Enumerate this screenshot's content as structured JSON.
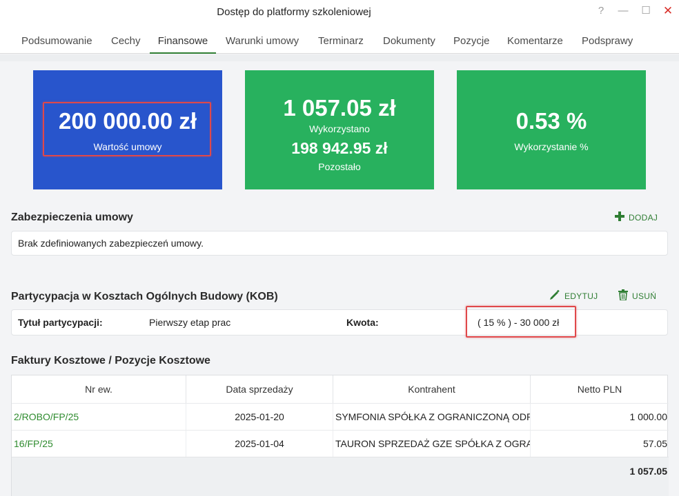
{
  "window": {
    "title": "Dostęp do platformy szkoleniowej",
    "help": "?",
    "minimize": "—",
    "maximize": "☐",
    "close": "✕"
  },
  "tabs": [
    {
      "label": "Podsumowanie"
    },
    {
      "label": "Cechy"
    },
    {
      "label": "Finansowe",
      "active": true
    },
    {
      "label": "Warunki umowy"
    },
    {
      "label": "Terminarz"
    },
    {
      "label": "Dokumenty"
    },
    {
      "label": "Pozycje"
    },
    {
      "label": "Komentarze"
    },
    {
      "label": "Podsprawy"
    }
  ],
  "tiles": {
    "contract_value": {
      "value": "200 000.00 zł",
      "label": "Wartość umowy"
    },
    "used": {
      "value": "1 057.05 zł",
      "label": "Wykorzystano",
      "remaining_value": "198 942.95 zł",
      "remaining_label": "Pozostało"
    },
    "usage_percent": {
      "value": "0.53 %",
      "label": "Wykorzystanie %"
    }
  },
  "securities": {
    "title": "Zabezpieczenia umowy",
    "add_label": "DODAJ",
    "empty_text": "Brak zdefiniowanych zabezpieczeń umowy."
  },
  "kob": {
    "title": "Partycypacja w Kosztach Ogólnych Budowy (KOB)",
    "edit_label": "EDYTUJ",
    "delete_label": "USUŃ",
    "title_label": "Tytuł partycypacji:",
    "title_value": "Pierwszy etap prac",
    "amount_label": "Kwota:",
    "amount_value": "( 15 % ) - 30 000 zł"
  },
  "invoices": {
    "title": "Faktury Kosztowe / Pozycje Kosztowe",
    "columns": [
      "Nr ew.",
      "Data sprzedaży",
      "Kontrahent",
      "Netto PLN"
    ],
    "rows": [
      {
        "nr": "2/ROBO/FP/25",
        "date": "2025-01-20",
        "contractor": "SYMFONIA SPÓŁKA Z OGRANICZONĄ ODPOWIEDZIALNOŚCIĄ",
        "net": "1 000.00"
      },
      {
        "nr": "16/FP/25",
        "date": "2025-01-04",
        "contractor": "TAURON SPRZEDAŻ GZE SPÓŁKA Z OGRANICZONĄ ODPOWIEDZIALNOŚCIĄ",
        "net": "57.05"
      }
    ],
    "total": "1 057.05"
  },
  "colors": {
    "accent_green": "#2e7d32",
    "tile_blue": "#2855cc",
    "tile_green": "#28b15e",
    "highlight_red": "#e0484a"
  }
}
